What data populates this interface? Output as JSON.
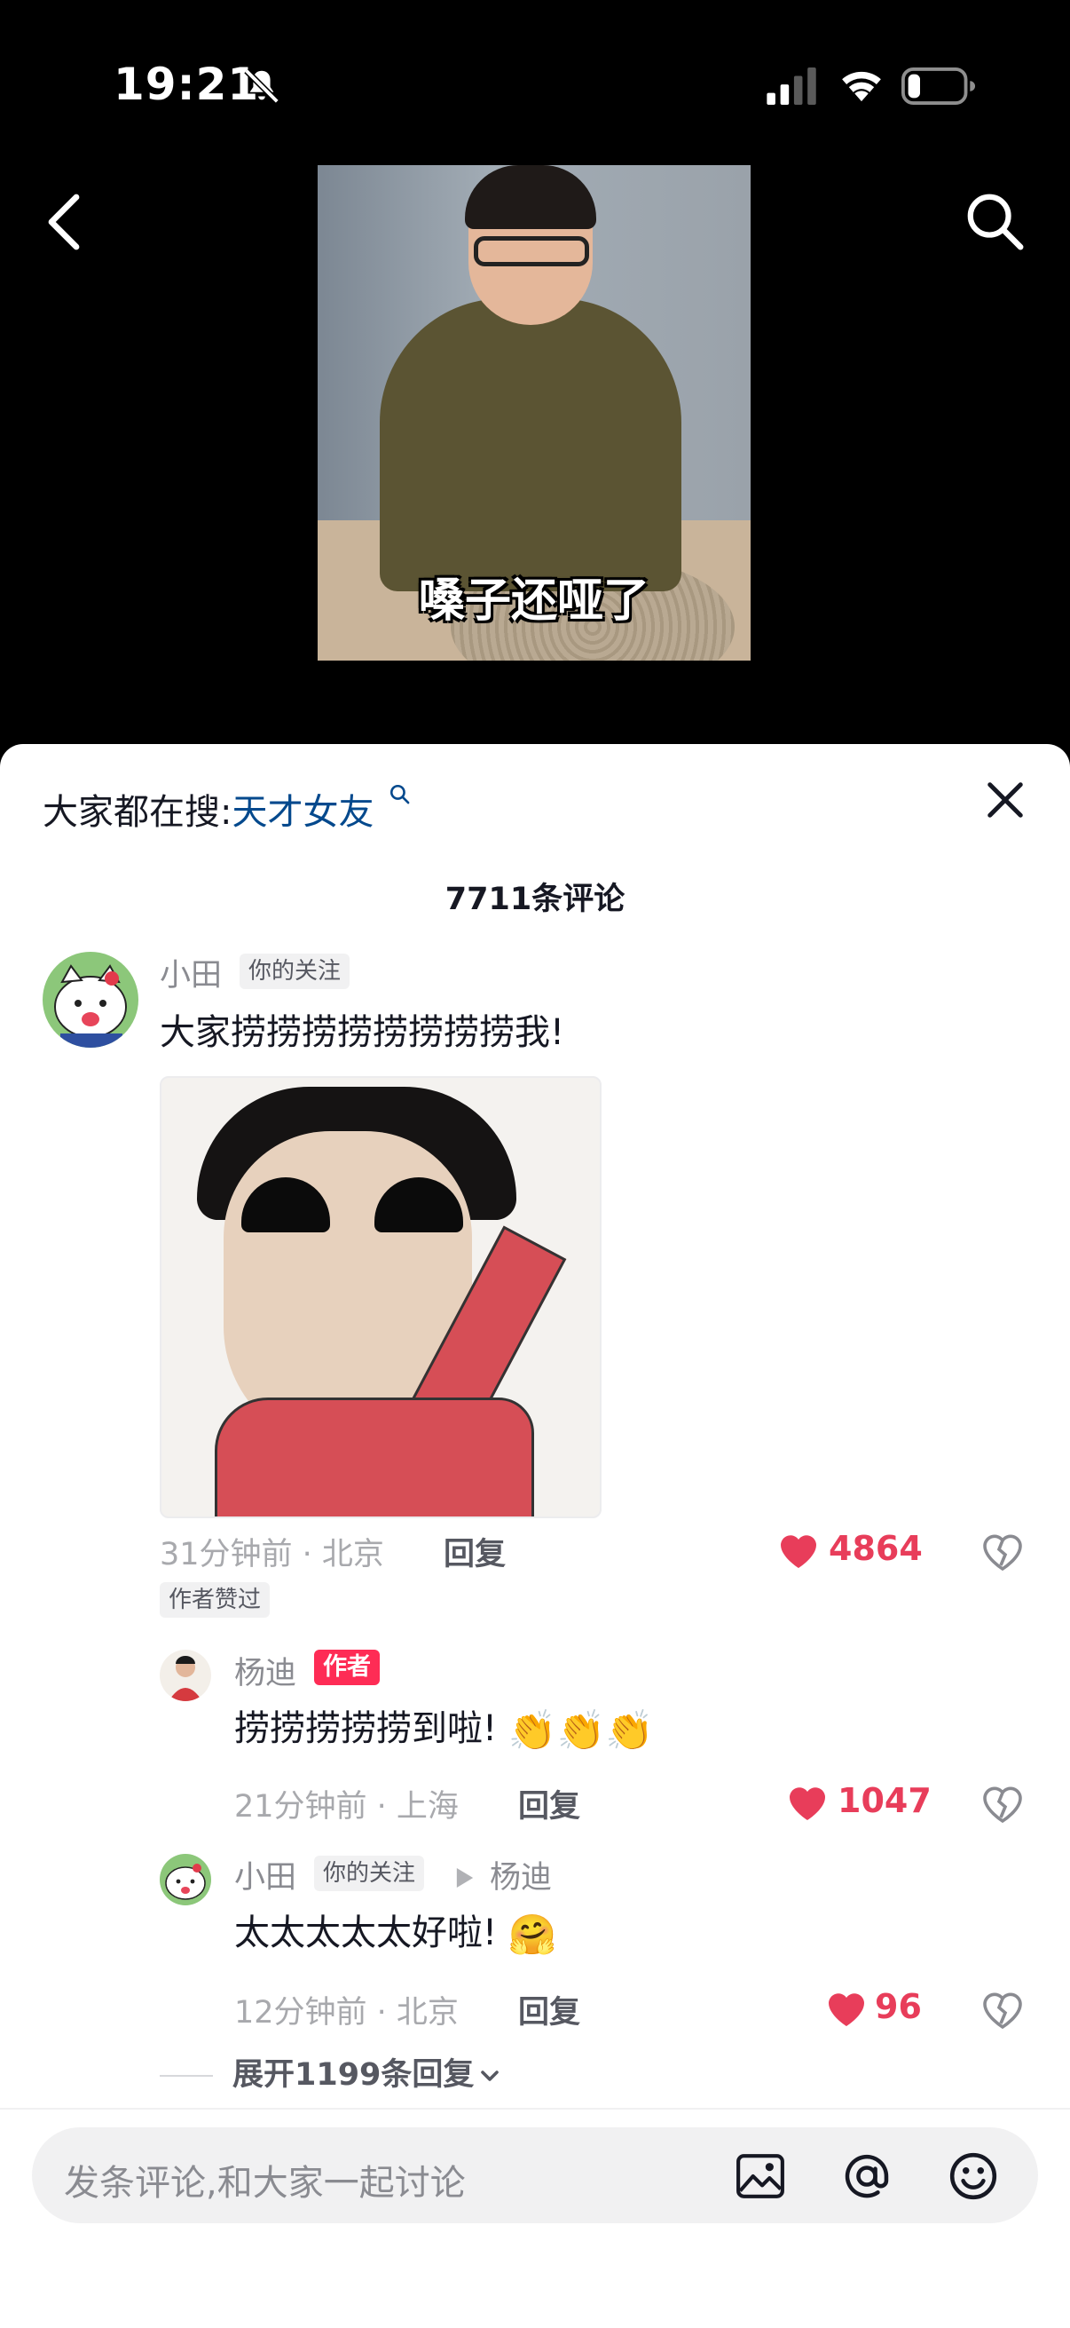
{
  "status_bar": {
    "time": "19:21"
  },
  "video": {
    "caption": "嗓子还哑了"
  },
  "hot_search": {
    "prefix": "大家都在搜:",
    "keyword": "天才女友"
  },
  "comments_count_label": "7711条评论",
  "comment": {
    "author": "小田",
    "follow_tag": "你的关注",
    "text": "大家捞捞捞捞捞捞捞捞我!",
    "time_location": "31分钟前 · 北京",
    "reply_label": "回复",
    "likes": "4864",
    "author_liked_tag": "作者赞过"
  },
  "replies": [
    {
      "author": "杨迪",
      "author_tag": "作者",
      "text": "捞捞捞捞捞到啦!",
      "emoji": "👏👏👏",
      "time_location": "21分钟前 · 上海",
      "reply_label": "回复",
      "likes": "1047"
    },
    {
      "author": "小田",
      "follow_tag": "你的关注",
      "reply_to": "杨迪",
      "text": "太太太太太好啦!",
      "emoji": "🤗",
      "time_location": "12分钟前 · 北京",
      "reply_label": "回复",
      "likes": "96"
    }
  ],
  "expand_label": "展开1199条回复",
  "input": {
    "placeholder": "发条评论,和大家一起讨论"
  },
  "colors": {
    "like_red": "#e83d5a",
    "keyword_blue": "#04498d",
    "author_tag_bg": "#fe2c55"
  },
  "icons": [
    "bell-slash-icon",
    "signal-icon",
    "wifi-icon",
    "battery-icon",
    "back-icon",
    "search-icon",
    "close-icon",
    "heart-icon",
    "dislike-icon",
    "image-icon",
    "at-icon",
    "emoji-icon",
    "chevron-down-icon"
  ]
}
